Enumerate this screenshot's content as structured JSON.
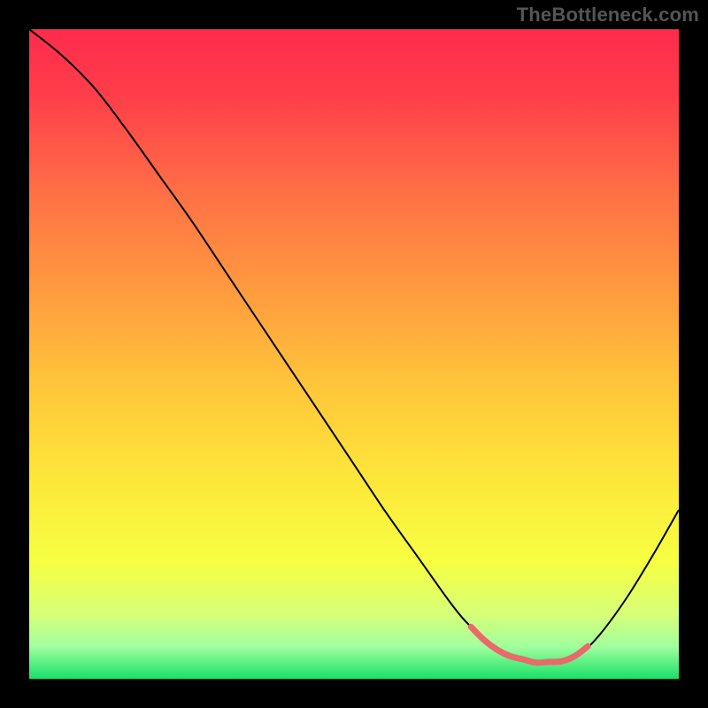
{
  "watermark": "TheBottleneck.com",
  "chart_data": {
    "type": "line",
    "title": "",
    "xlabel": "",
    "ylabel": "",
    "xlim": [
      0,
      100
    ],
    "ylim": [
      0,
      100
    ],
    "grid": false,
    "legend": false,
    "background_gradient": {
      "stops": [
        {
          "offset": 0.0,
          "color": "#ff2b4c"
        },
        {
          "offset": 0.1,
          "color": "#ff3d4a"
        },
        {
          "offset": 0.25,
          "color": "#ff6f45"
        },
        {
          "offset": 0.4,
          "color": "#ff9a3f"
        },
        {
          "offset": 0.55,
          "color": "#ffc63a"
        },
        {
          "offset": 0.7,
          "color": "#fde83a"
        },
        {
          "offset": 0.82,
          "color": "#f6ff42"
        },
        {
          "offset": 0.9,
          "color": "#d7ff77"
        },
        {
          "offset": 0.95,
          "color": "#a2ff9e"
        },
        {
          "offset": 1.0,
          "color": "#19e06b"
        }
      ]
    },
    "series": [
      {
        "name": "bottleneck-curve",
        "color": "#000000",
        "width": 2,
        "x": [
          0,
          5,
          10,
          15,
          20,
          25,
          30,
          35,
          40,
          45,
          50,
          55,
          60,
          65,
          68,
          72,
          75,
          78,
          82,
          85,
          88,
          92,
          96,
          100
        ],
        "y": [
          100,
          96,
          91,
          84.5,
          77.5,
          70.5,
          63,
          55.5,
          48,
          40.5,
          33,
          25.5,
          18.5,
          11.5,
          8,
          4.5,
          3,
          2.5,
          2.7,
          4,
          7,
          12.5,
          19,
          26
        ]
      },
      {
        "name": "optimal-zone-marker",
        "color": "#e96a6a",
        "width": 7,
        "linecap": "round",
        "x": [
          68,
          70,
          72,
          74,
          76,
          78,
          80,
          82,
          84,
          86
        ],
        "y": [
          8,
          6,
          4.5,
          3.5,
          3,
          2.5,
          2.6,
          2.7,
          3.5,
          5
        ]
      }
    ]
  }
}
